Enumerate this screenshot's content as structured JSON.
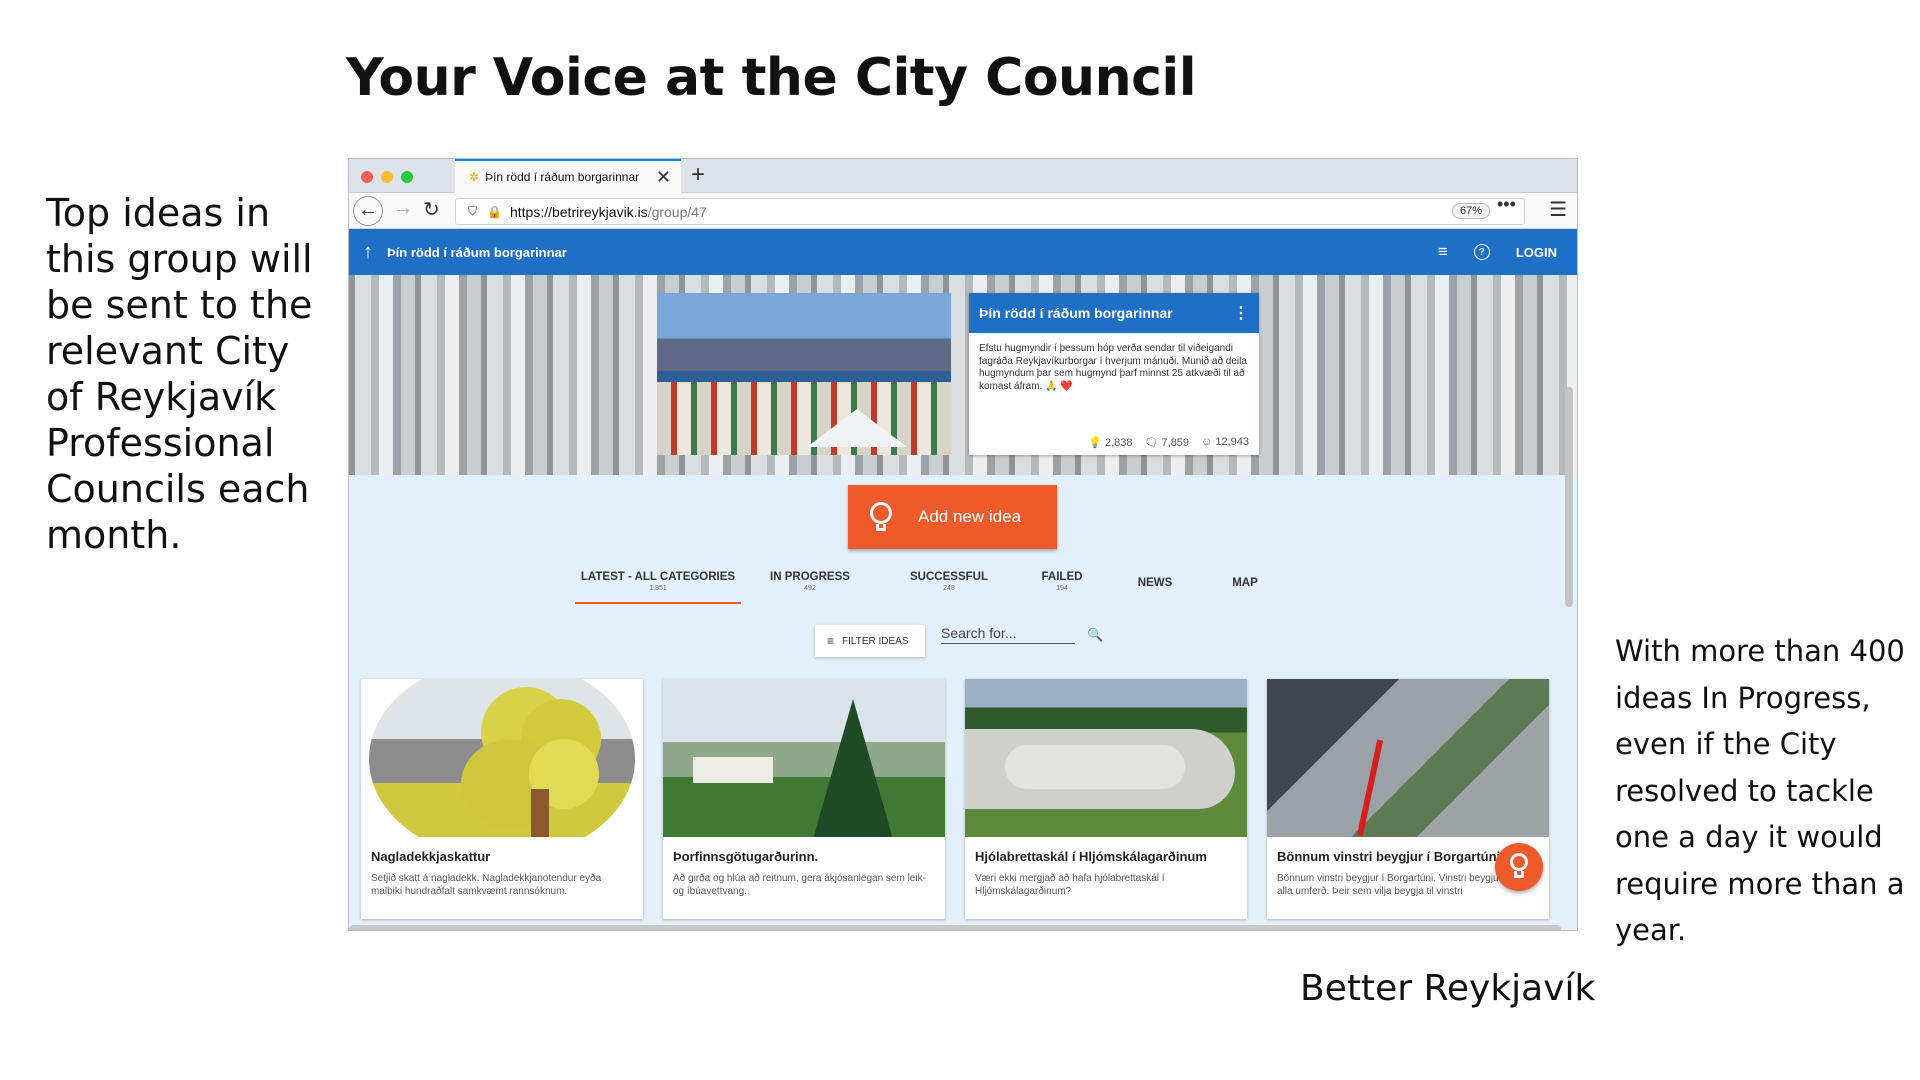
{
  "slide": {
    "title": "Your Voice at the City Council",
    "left_note": "Top ideas in this group will be sent to the relevant City of Reykjavík Professional Councils each month.",
    "right_note": "With more than 400 ideas In Progress, even if the City resolved to tackle one a day it would require more than a year.",
    "caption": "Better Reykjavík"
  },
  "browser": {
    "tab_title": "Þín rödd í ráðum borgarinnar",
    "tab_close": "✕",
    "new_tab": "+",
    "url_host": "https://betrireykjavik.is",
    "url_path": "/group/47",
    "zoom": "67%",
    "menu_dots": "•••",
    "menu": "☰"
  },
  "app": {
    "group_name": "Þín rödd í ráðum borgarinnar",
    "login": "LOGIN",
    "card_title": "Þín rödd í ráðum borgarinnar",
    "card_desc": "Efstu hugmyndir í þessum hóp verða sendar til viðeigandi fagráða Reykjavíkurborgar í hverjum mánuði. Munið að deila hugmyndum þar sem hugmynd þarf minnst 25 atkvæði til að komast áfram. 🙏 ❤️",
    "stats": {
      "ideas": "2,838",
      "comments": "7,859",
      "users": "12,943"
    },
    "add_idea": "Add new idea",
    "tabs": [
      {
        "label": "LATEST - ALL CATEGORIES",
        "count": "1,851"
      },
      {
        "label": "IN PROGRESS",
        "count": "492"
      },
      {
        "label": "SUCCESSFUL",
        "count": "248"
      },
      {
        "label": "FAILED",
        "count": "194"
      },
      {
        "label": "NEWS",
        "count": ""
      },
      {
        "label": "MAP",
        "count": ""
      }
    ],
    "filter_label": "FILTER IDEAS",
    "search_placeholder": "Search for...",
    "ideas": [
      {
        "title": "Nagladekkjaskattur",
        "desc": "Setjið skatt á nagladekk. Nagladekkjanotendur eyða malbiki hundraðfalt samkvæmt rannsóknum."
      },
      {
        "title": "Þorfinnsgötugarðurinn.",
        "desc": "Að girða og hlúa að reitnum, gera ákjósanlegan sem leik- og íbúavettvang."
      },
      {
        "title": "Hjólabrettaskál í Hljómskálagarðinum",
        "desc": "Væri ekki mergjað að hafa hjólabrettaskál í Hljómskálagarðinum?"
      },
      {
        "title": "Bönnum vinstri beygjur í Borgartúni",
        "desc": "Bönnum vinstri beygjur í Borgartúni. Vinstri beygjur stoppa alla umferð. Þeir sem vilja beygja til vinstri"
      }
    ]
  },
  "colors": {
    "primary": "#1e6fc5",
    "accent": "#ef5a2b",
    "background": "#e3f0fb"
  }
}
